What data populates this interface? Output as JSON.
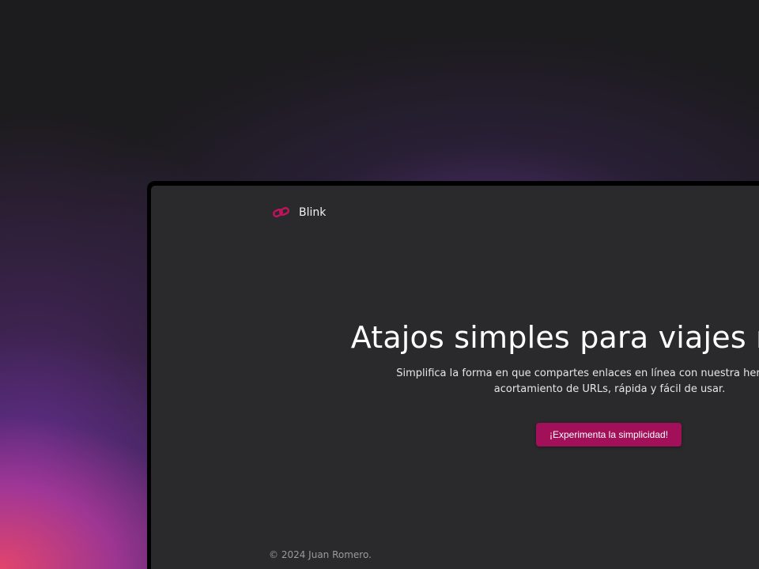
{
  "nav": {
    "brand": "Blink",
    "logo_icon": "link-icon",
    "accent_color": "#c0145e"
  },
  "hero": {
    "title": "Atajos simples para viajes rápidos",
    "subtitle": "Simplifica la forma en que compartes enlaces en línea con nuestra herramienta de acortamiento de URLs, rápida y fácil de usar.",
    "cta_label": "¡Experimenta la simplicidad!"
  },
  "footer": {
    "copyright": "© 2024 Juan Romero."
  },
  "colors": {
    "page_background": "#1c1b1d",
    "screen_background": "#2a292b",
    "button_background": "#a3105a"
  }
}
